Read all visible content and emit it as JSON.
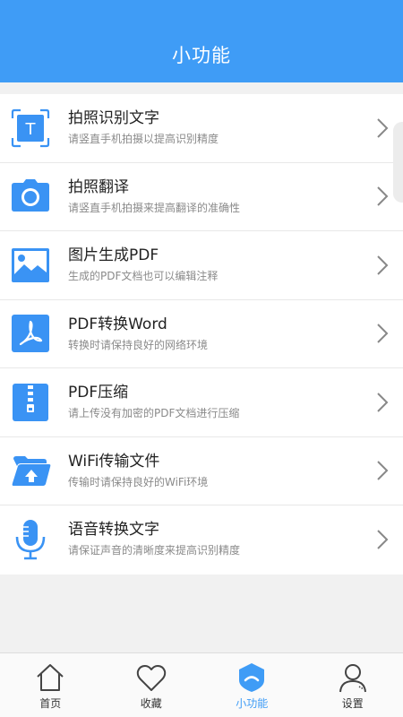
{
  "header": {
    "title": "小功能"
  },
  "features": [
    {
      "title": "拍照识别文字",
      "desc": "请竖直手机拍摄以提高识别精度",
      "icon": "text-scan-icon"
    },
    {
      "title": "拍照翻译",
      "desc": "请竖直手机拍摄来提高翻译的准确性",
      "icon": "camera-icon"
    },
    {
      "title": "图片生成PDF",
      "desc": "生成的PDF文档也可以编辑注释",
      "icon": "image-icon"
    },
    {
      "title": "PDF转换Word",
      "desc": "转换时请保持良好的网络环境",
      "icon": "pdf-icon"
    },
    {
      "title": "PDF压缩",
      "desc": "请上传没有加密的PDF文档进行压缩",
      "icon": "zip-icon"
    },
    {
      "title": "WiFi传输文件",
      "desc": "传输时请保持良好的WiFi环境",
      "icon": "folder-upload-icon"
    },
    {
      "title": "语音转换文字",
      "desc": "请保证声音的清晰度来提高识别精度",
      "icon": "microphone-icon"
    }
  ],
  "tabbar": {
    "items": [
      {
        "label": "首页",
        "icon": "home-icon"
      },
      {
        "label": "收藏",
        "icon": "heart-icon"
      },
      {
        "label": "小功能",
        "icon": "shield-icon"
      },
      {
        "label": "设置",
        "icon": "person-icon"
      }
    ],
    "active_index": 2
  },
  "colors": {
    "accent": "#3f9cf6",
    "icon_blue": "#3a93f4",
    "text_dark": "#222222",
    "text_gray": "#8a8a8a"
  }
}
